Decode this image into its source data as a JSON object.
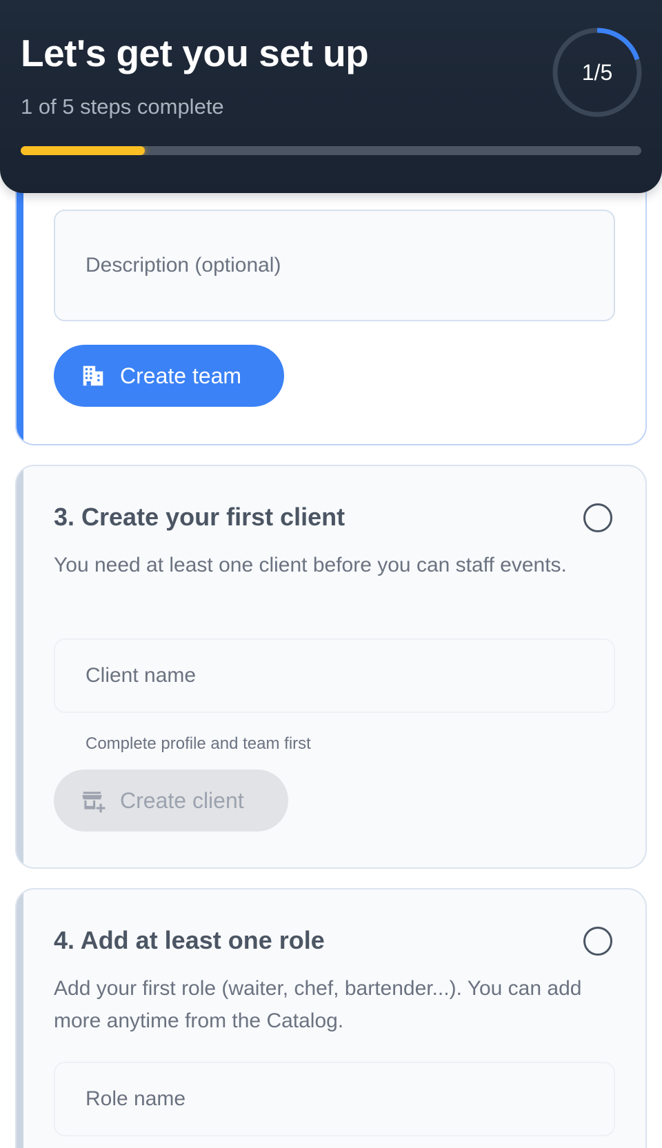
{
  "header": {
    "title": "Let's get you set up",
    "subtitle": "1 of 5 steps complete",
    "progress_label": "1/5",
    "progress_fraction": 0.2,
    "progress_bar_color": "#fbbf24",
    "ring_color": "#3b82f6"
  },
  "team_step": {
    "description_placeholder": "Description (optional)",
    "button_label": "Create team",
    "button_icon": "building-icon",
    "accent_color": "#3b82f6"
  },
  "client_step": {
    "title": "3. Create your first client",
    "description": "You need at least one client before you can staff events.",
    "input_placeholder": "Client name",
    "helper_text": "Complete profile and team first",
    "button_label": "Create client",
    "button_icon": "store-add-icon",
    "status": "incomplete"
  },
  "role_step": {
    "title": "4. Add at least one role",
    "description": "Add your first role (waiter, chef, bartender...). You can add more anytime from the Catalog.",
    "input_placeholder": "Role name",
    "status": "incomplete"
  }
}
